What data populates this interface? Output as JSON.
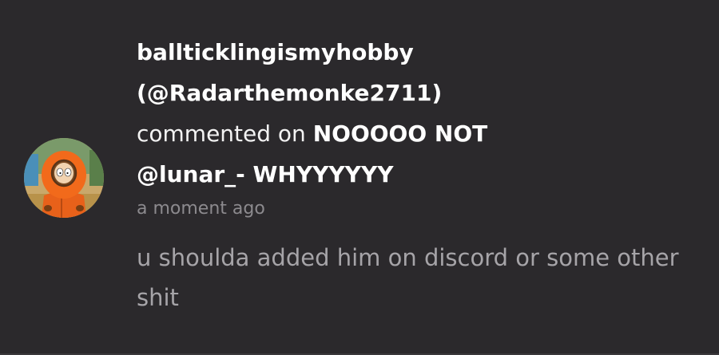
{
  "notification": {
    "user_display_name": "ballticklingismyhobby",
    "user_handle": "(@Radarthemonke2711)",
    "action_text": "commented on",
    "target_line_1": "NOOOOO NOT",
    "target_line_2": "@lunar_- WHYYYYYY",
    "timestamp": "a moment ago",
    "comment_text": "u shoulda added him on discord or some other shit",
    "avatar_icon": "kenny-avatar-icon"
  },
  "colors": {
    "background": "#2b292c",
    "primary_text": "#ffffff",
    "timestamp_text": "#8c8a8e",
    "comment_text": "#a6a4a8",
    "avatar_parka": "#f26a1b"
  }
}
